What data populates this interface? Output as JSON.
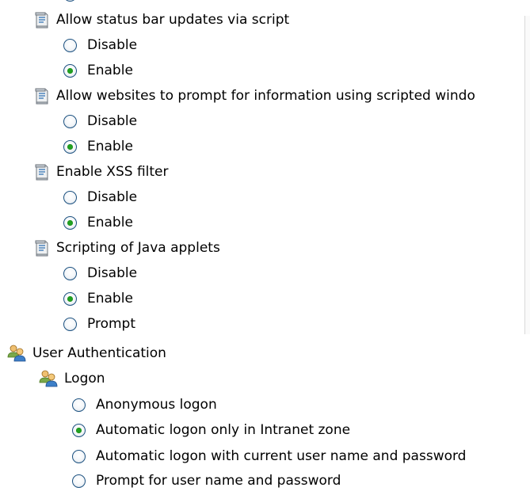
{
  "scripting": {
    "items": [
      {
        "label": "Allow status bar updates via script",
        "options": [
          {
            "label": "Disable",
            "selected": false
          },
          {
            "label": "Enable",
            "selected": true
          }
        ]
      },
      {
        "label": "Allow websites to prompt for information using scripted windo",
        "options": [
          {
            "label": "Disable",
            "selected": false
          },
          {
            "label": "Enable",
            "selected": true
          }
        ]
      },
      {
        "label": "Enable XSS filter",
        "options": [
          {
            "label": "Disable",
            "selected": false
          },
          {
            "label": "Enable",
            "selected": true
          }
        ]
      },
      {
        "label": "Scripting of Java applets",
        "options": [
          {
            "label": "Disable",
            "selected": false
          },
          {
            "label": "Enable",
            "selected": true
          },
          {
            "label": "Prompt",
            "selected": false
          }
        ]
      }
    ]
  },
  "user_auth": {
    "label": "User Authentication",
    "logon": {
      "label": "Logon",
      "options": [
        {
          "label": "Anonymous logon",
          "selected": false
        },
        {
          "label": "Automatic logon only in Intranet zone",
          "selected": true
        },
        {
          "label": "Automatic logon with current user name and password",
          "selected": false
        },
        {
          "label": "Prompt for user name and password",
          "selected": false
        }
      ]
    }
  },
  "colors": {
    "radio_border": "#1c5180",
    "radio_selected_dot": "#21a121"
  }
}
